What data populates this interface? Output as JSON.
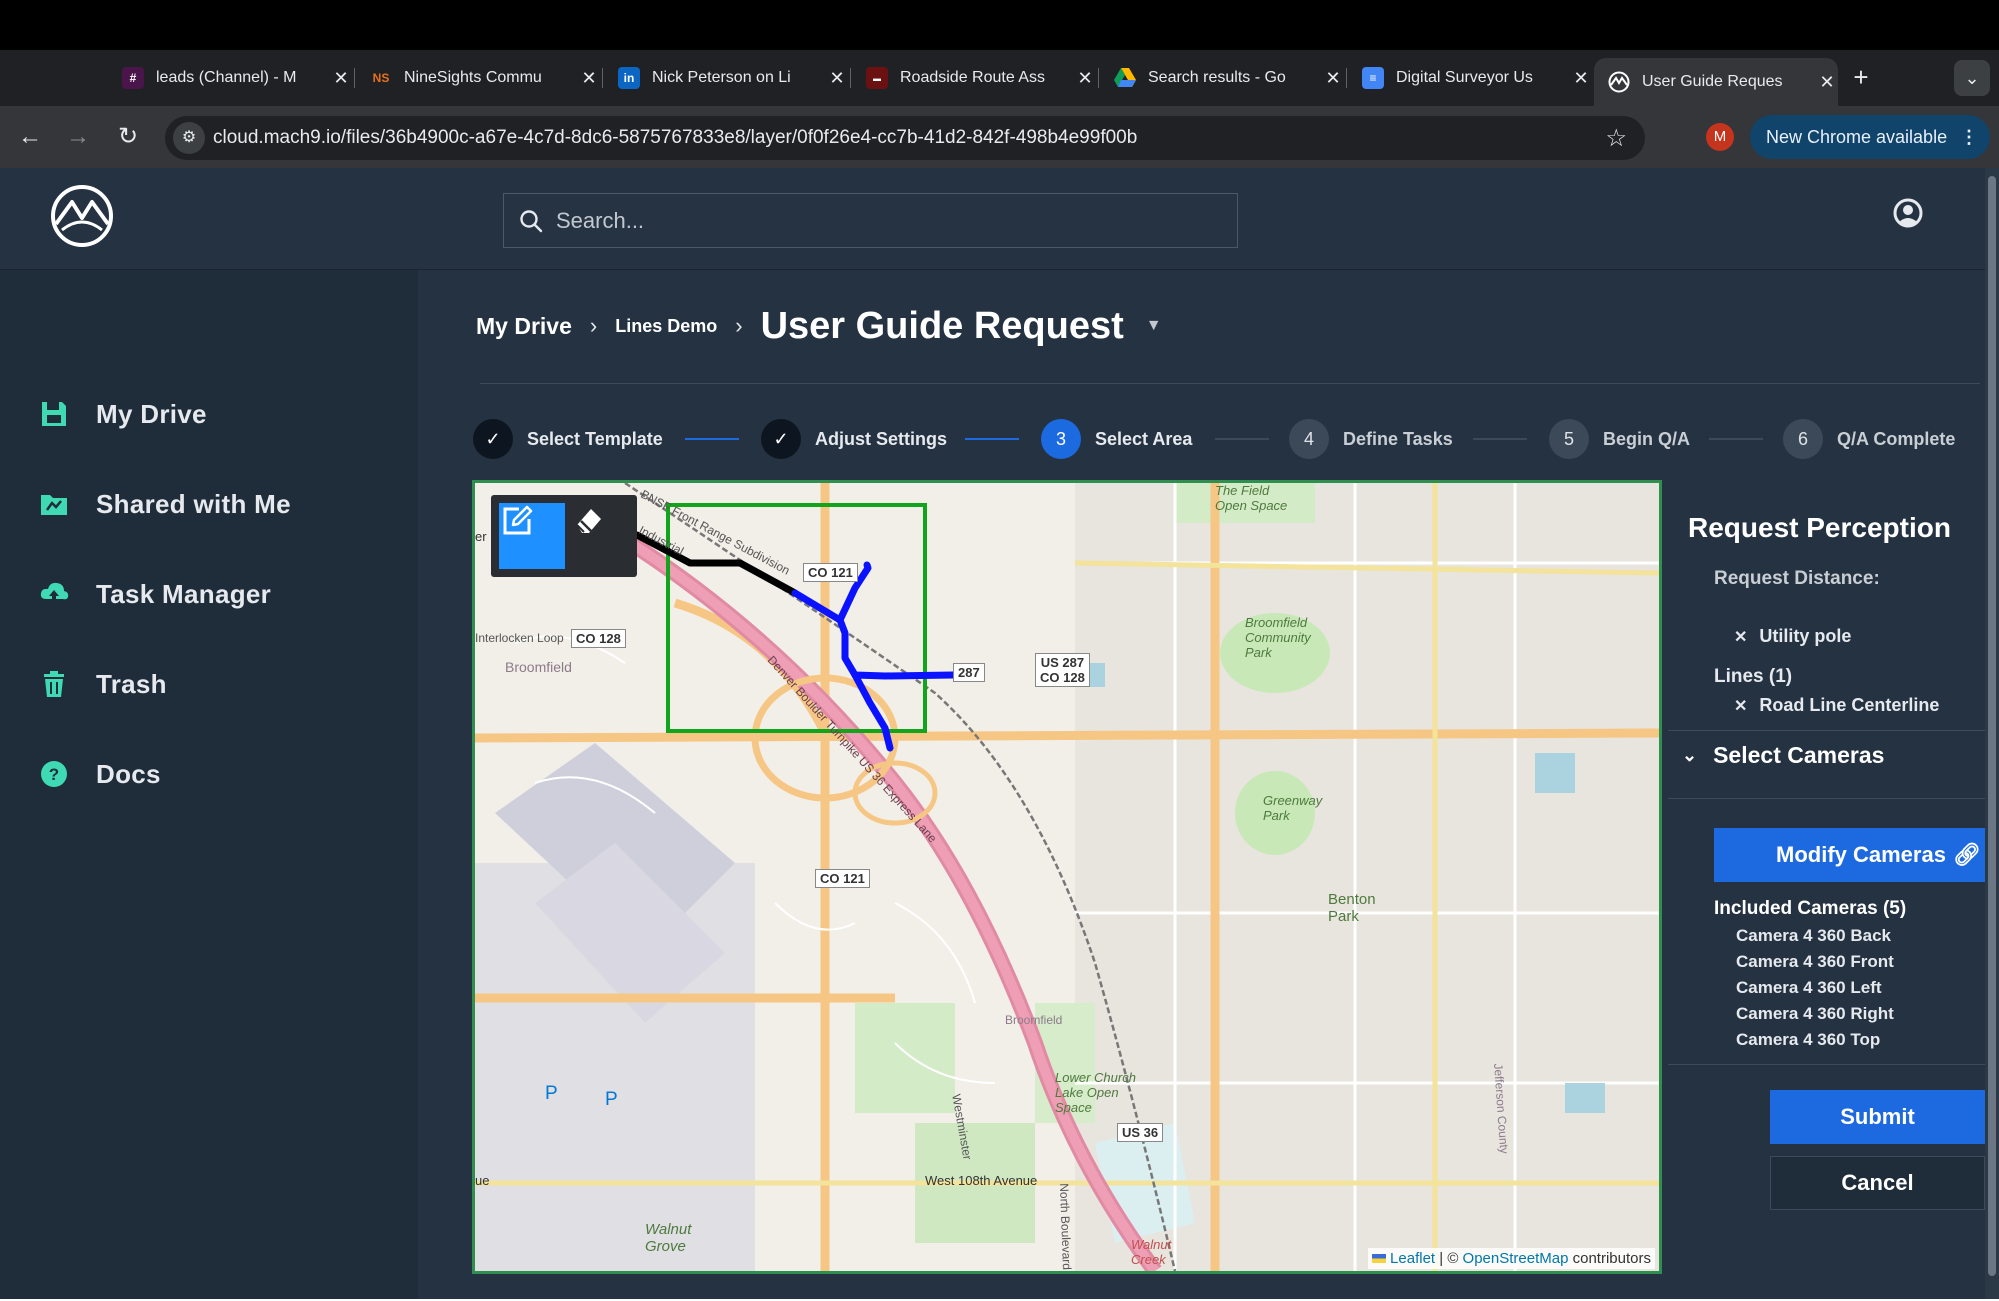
{
  "browser": {
    "tabs": [
      {
        "title": "leads (Channel) - M",
        "icon": "slack-icon",
        "color": "#e01e5a"
      },
      {
        "title": "NineSights Commu",
        "icon": "ninesights-icon",
        "color": "#e8711c"
      },
      {
        "title": "Nick Peterson on Li",
        "icon": "linkedin-icon",
        "color": "#0a66c2"
      },
      {
        "title": "Roadside Route Ass",
        "icon": "roadside-icon",
        "color": "#b22222"
      },
      {
        "title": "Search results - Go",
        "icon": "google-drive-icon",
        "color": "#34a853"
      },
      {
        "title": "Digital Surveyor Us",
        "icon": "google-docs-icon",
        "color": "#4285f4"
      },
      {
        "title": "User Guide Reques",
        "icon": "mach9-icon",
        "color": "#ffffff"
      }
    ],
    "tab_close": "✕",
    "new_tab": "+",
    "url": "cloud.mach9.io/files/36b4900c-a67e-4c7d-8dc6-5875767833e8/layer/0f0f26e4-cc7b-41d2-842f-498b4e99f00b",
    "profile_initial": "M",
    "new_chrome": "New Chrome available"
  },
  "header": {
    "search_placeholder": "Search..."
  },
  "sidebar": {
    "items": [
      {
        "label": "My Drive",
        "icon": "drive-icon"
      },
      {
        "label": "Shared with Me",
        "icon": "shared-folder-icon"
      },
      {
        "label": "Task Manager",
        "icon": "cloud-upload-icon"
      },
      {
        "label": "Trash",
        "icon": "trash-icon"
      },
      {
        "label": "Docs",
        "icon": "help-icon"
      }
    ]
  },
  "breadcrumb": {
    "root": "My Drive",
    "folder": "Lines Demo",
    "title": "User Guide Request"
  },
  "stepper": {
    "steps": [
      {
        "num": "✓",
        "label": "Select Template",
        "state": "done"
      },
      {
        "num": "✓",
        "label": "Adjust Settings",
        "state": "done"
      },
      {
        "num": "3",
        "label": "Select Area",
        "state": "active"
      },
      {
        "num": "4",
        "label": "Define Tasks",
        "state": "todo"
      },
      {
        "num": "5",
        "label": "Begin Q/A",
        "state": "todo"
      },
      {
        "num": "6",
        "label": "Q/A Complete",
        "state": "todo"
      }
    ]
  },
  "map": {
    "labels": {
      "co121_a": "CO 121",
      "co128": "CO 128",
      "interlocken": "Interlocken Loop",
      "broomfield": "Broomfield",
      "n287": "287",
      "us287": "US 287",
      "co128b": "CO 128",
      "co121_b": "CO 121",
      "broomfield_park": "Broomfield Community Park",
      "greenway": "Greenway Park",
      "benton": "Benton Park",
      "lower_church": "Lower Church Lake Open Space",
      "us36": "US 36",
      "west108": "West 108th Avenue",
      "walnut_grove": "Walnut Grove",
      "walnut_creek": "Walnut Creek",
      "open_space": "The Field Open Space",
      "turnpike": "Denver Boulder Turnpike US 36 Express Lane",
      "bnsf": "BNSF Front Range Subdivision",
      "broomfield2": "Broomfield",
      "park_p1": "P",
      "park_p2": "P",
      "westminster": "Westminster",
      "north_blvd": "North Boulevard",
      "jefferson": "Jefferson County",
      "industrial": "Industrial",
      "ue": "ue",
      "er": "er"
    },
    "attribution": {
      "leaflet": "Leaflet",
      "sep": " | © ",
      "osm": "OpenStreetMap",
      "rest": " contributors"
    }
  },
  "panel": {
    "title": "Request Perception",
    "request_distance": "Request Distance:",
    "chip_remove": "✕",
    "points": [
      "Utility pole"
    ],
    "lines_header": "Lines (1)",
    "lines": [
      "Road Line Centerline"
    ],
    "select_cameras": "Select Cameras",
    "modify_cameras": "Modify Cameras",
    "included_header": "Included Cameras (5)",
    "cameras": [
      "Camera 4 360 Back",
      "Camera 4 360 Front",
      "Camera 4 360 Left",
      "Camera 4 360 Right",
      "Camera 4 360 Top"
    ],
    "submit": "Submit",
    "cancel": "Cancel"
  },
  "colors": {
    "accent": "#1d6ae0",
    "sidebar_icon": "#3fd9b4",
    "selection_box": "#12a51b",
    "drawn_line_blue": "#0a12ff",
    "drawn_line_black": "#000000"
  }
}
